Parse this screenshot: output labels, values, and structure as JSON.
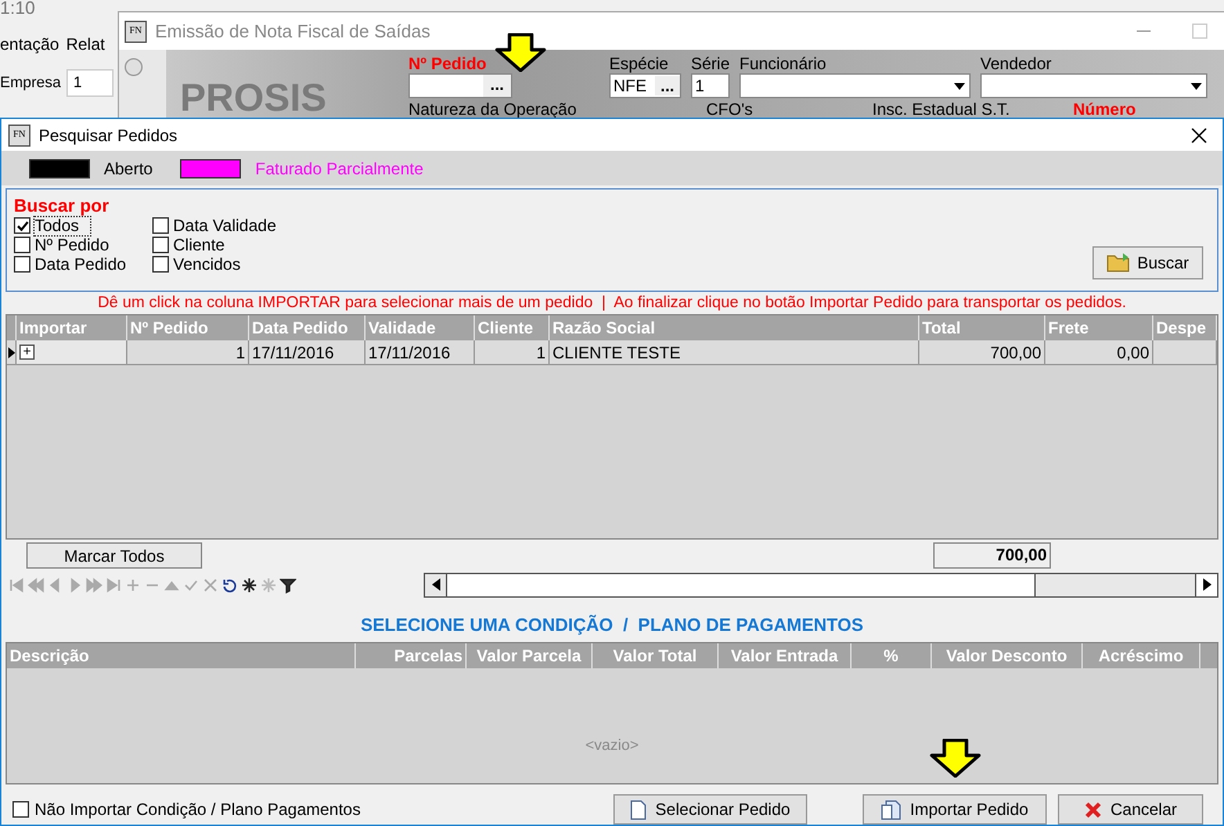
{
  "clock": "1:10",
  "background_app": {
    "menu": [
      "entação",
      "Relat"
    ],
    "company_label": "Empresa",
    "company_value": "1"
  },
  "app_icon_text": "FN",
  "dialog_icon_text": "FN",
  "back_window": {
    "title": "Emissão de Nota Fiscal de Saídas",
    "logo": "PROSIS",
    "radio_selected": false,
    "order_field": {
      "label": "Nº Pedido",
      "button": "..."
    },
    "species_field": {
      "label": "Espécie",
      "value": "NFE",
      "button": "..."
    },
    "series_field": {
      "label": "Série",
      "value": "1"
    },
    "employee_field": {
      "label": "Funcionário"
    },
    "seller_field": {
      "label": "Vendedor"
    },
    "row_2_labels": [
      {
        "text": "Natureza da Operação",
        "highlight": false
      },
      {
        "text": "CFO's",
        "highlight": false
      },
      {
        "text": "Insc. Estadual S.T.",
        "highlight": false
      },
      {
        "text": "Número",
        "highlight": true
      }
    ]
  },
  "dialog": {
    "title": "Pesquisar Pedidos",
    "legend": [
      {
        "label": "Aberto",
        "color": "#000000"
      },
      {
        "label": "Faturado Parcialmente",
        "color": "#ff00ff"
      }
    ],
    "search": {
      "title": "Buscar por",
      "options": [
        {
          "label": "Todos",
          "checked": true
        },
        {
          "label": "Nº Pedido",
          "checked": false
        },
        {
          "label": "Data Pedido",
          "checked": false
        },
        {
          "label": "Data Validade",
          "checked": false
        },
        {
          "label": "Cliente",
          "checked": false
        },
        {
          "label": "Vencidos",
          "checked": false
        }
      ],
      "button": "Buscar"
    },
    "hint": "Dê um click na coluna IMPORTAR para selecionar mais de um pedido  |  Ao finalizar clique no botão Importar Pedido para transportar os pedidos.",
    "orders": {
      "columns": [
        "Importar",
        "Nº Pedido",
        "Data Pedido",
        "Validade",
        "Cliente",
        "Razão Social",
        "Total",
        "Frete",
        "Despe"
      ],
      "rows": [
        {
          "expand": "+",
          "cells": [
            "",
            "1",
            "17/11/2016",
            "17/11/2016",
            "1",
            "CLIENTE TESTE",
            "700,00",
            "0,00",
            ""
          ]
        }
      ]
    },
    "mark_all_button": "Marcar Todos",
    "total": "700,00",
    "payments_title": "SELECIONE UMA CONDIÇÃO  /  PLANO DE PAGAMENTOS",
    "payments": {
      "columns": [
        "Descrição",
        "Parcelas",
        "Valor Parcela",
        "Valor Total",
        "Valor Entrada",
        "%",
        "Valor Desconto",
        "Acréscimo"
      ],
      "empty": "<vazio>"
    },
    "skip_payment": {
      "label": "Não Importar Condição / Plano Pagamentos",
      "checked": false
    },
    "buttons": [
      {
        "kind": "select",
        "label": "Selecionar Pedido"
      },
      {
        "kind": "import",
        "label": "Importar Pedido"
      },
      {
        "kind": "cancel",
        "label": "Cancelar"
      }
    ]
  }
}
